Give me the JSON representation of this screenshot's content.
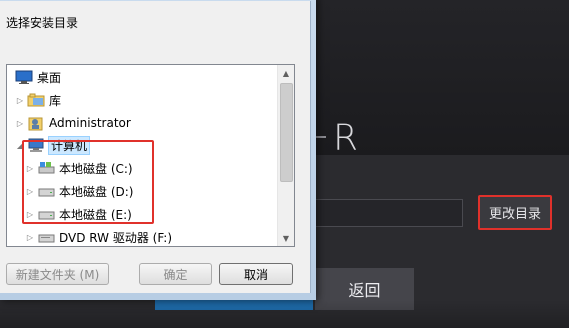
{
  "app": {
    "logo_letter": "R",
    "change_dir_label": "更改目录",
    "back_label": "返回"
  },
  "dialog": {
    "title": "选择安装目录",
    "tree": {
      "desktop": "桌面",
      "library": "库",
      "administrator": "Administrator",
      "computer": "计算机",
      "drive_c": "本地磁盘 (C:)",
      "drive_d": "本地磁盘 (D:)",
      "drive_e": "本地磁盘 (E:)",
      "dvd": "DVD RW 驱动器 (F:)"
    },
    "buttons": {
      "new_folder": "新建文件夹 (M)",
      "ok": "确定",
      "cancel": "取消"
    }
  },
  "colors": {
    "highlight_red": "#e0312b",
    "selection_blue": "#cce8ff"
  },
  "icons": [
    "desktop-icon",
    "library-icon",
    "user-folder-icon",
    "computer-icon",
    "drive-icon",
    "dvd-drive-icon"
  ]
}
